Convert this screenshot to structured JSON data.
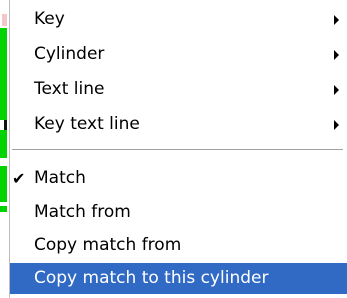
{
  "menu": {
    "submenu_items": [
      {
        "label": "Key",
        "has_submenu": true
      },
      {
        "label": "Cylinder",
        "has_submenu": true
      },
      {
        "label": "Text line",
        "has_submenu": true
      },
      {
        "label": "Key text line",
        "has_submenu": true
      }
    ],
    "action_items": [
      {
        "label": "Match",
        "checked": true
      },
      {
        "label": "Match from",
        "checked": false
      },
      {
        "label": "Copy match from",
        "checked": false
      },
      {
        "label": "Copy match to this cylinder",
        "checked": false,
        "highlighted": true
      }
    ],
    "check_glyph": "✔"
  },
  "colors": {
    "highlight": "#316ac5",
    "highlight_text": "#ffffff",
    "background_strip_green": "#00d400"
  }
}
